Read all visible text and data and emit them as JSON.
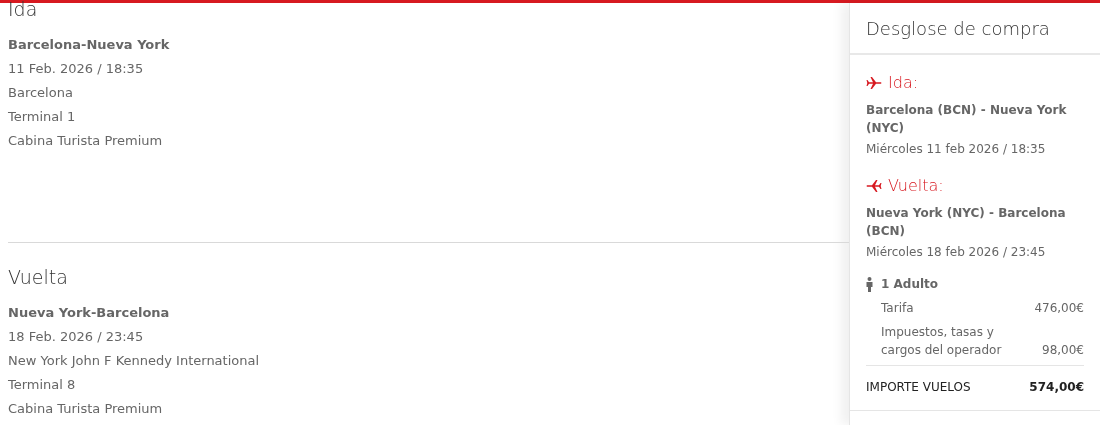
{
  "flights": [
    {
      "heading": "Ida",
      "route": "Barcelona-Nueva York",
      "datetime": "11 Feb. 2026 / 18:35",
      "airport": "Barcelona",
      "terminal": "Terminal 1",
      "cabin": "Cabina Turista Premium"
    },
    {
      "heading": "Vuelta",
      "route": "Nueva York-Barcelona",
      "datetime": "18 Feb. 2026 / 23:45",
      "airport": "New York John F Kennedy International",
      "terminal": "Terminal 8",
      "cabin": "Cabina Turista Premium"
    }
  ],
  "summary": {
    "title": "Desglose de compra",
    "legs": [
      {
        "kind": "outbound",
        "label": "Ida:",
        "route": "Barcelona (BCN) - Nueva York (NYC)",
        "datetime": "Miércoles 11 feb 2026 / 18:35"
      },
      {
        "kind": "return",
        "label": "Vuelta:",
        "route": "Nueva York (NYC) - Barcelona (BCN)",
        "datetime": "Miércoles 18 feb 2026 / 23:45"
      }
    ],
    "passengers": "1 Adulto",
    "charges": [
      {
        "label": "Tarifa",
        "amount": "476,00€"
      },
      {
        "label": "Impuestos, tasas y cargos del operador",
        "amount": "98,00€"
      }
    ],
    "total": {
      "label": "IMPORTE VUELOS",
      "amount": "574,00€"
    }
  }
}
